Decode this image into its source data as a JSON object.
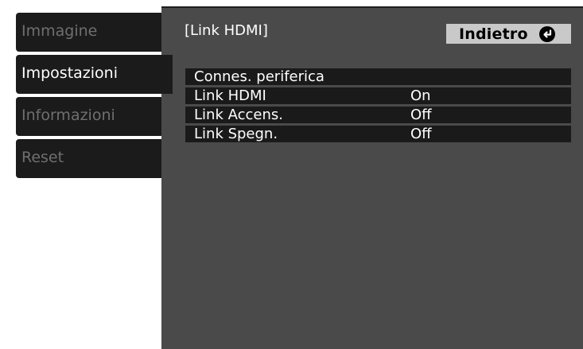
{
  "sidebar": {
    "items": [
      {
        "label": "Immagine",
        "state": "inactive"
      },
      {
        "label": "Impostazioni",
        "state": "selected"
      },
      {
        "label": "Informazioni",
        "state": "inactive"
      },
      {
        "label": "Reset",
        "state": "inactive"
      }
    ]
  },
  "panel": {
    "title": "[Link HDMI]",
    "back_label": "Indietro",
    "back_icon": "return-arrow-icon",
    "rows": [
      {
        "label": "Connes. periferica",
        "value": ""
      },
      {
        "label": "Link HDMI",
        "value": "On"
      },
      {
        "label": "Link Accens.",
        "value": "Off"
      },
      {
        "label": "Link Spegn.",
        "value": "Off"
      }
    ]
  },
  "colors": {
    "panel_bg": "#4a4a4a",
    "tab_bg": "#1b1b1b",
    "row_bg": "#1a1a1a",
    "selected_text": "#ffffff",
    "inactive_text": "#6f6f6f",
    "back_button_bg": "#c9c9c9"
  }
}
